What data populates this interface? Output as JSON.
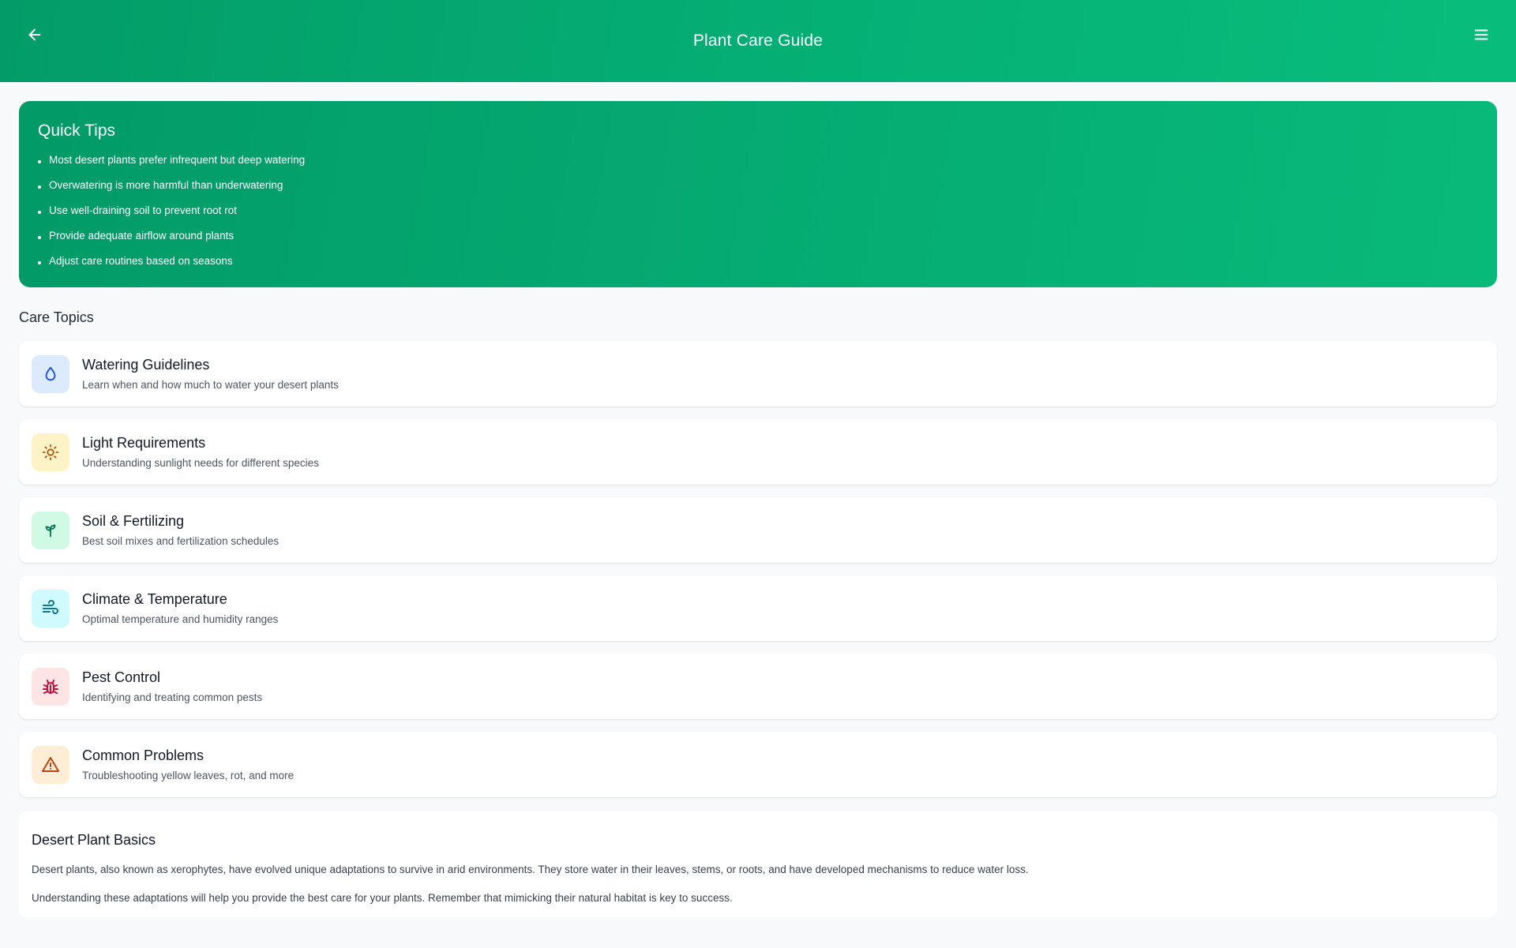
{
  "header": {
    "title": "Plant Care Guide"
  },
  "quick_tips": {
    "title": "Quick Tips",
    "items": [
      "Most desert plants prefer infrequent but deep watering",
      "Overwatering is more harmful than underwatering",
      "Use well-draining soil to prevent root rot",
      "Provide adequate airflow around plants",
      "Adjust care routines based on seasons"
    ]
  },
  "care_topics": {
    "heading": "Care Topics",
    "items": [
      {
        "title": "Watering Guidelines",
        "description": "Learn when and how much to water your desert plants",
        "icon": "water-drop-icon",
        "icon_color": "#1d4ed8",
        "icon_bg": "#dbeafe"
      },
      {
        "title": "Light Requirements",
        "description": "Understanding sunlight needs for different species",
        "icon": "sun-icon",
        "icon_color": "#b45309",
        "icon_bg": "#fef3c7"
      },
      {
        "title": "Soil & Fertilizing",
        "description": "Best soil mixes and fertilization schedules",
        "icon": "sprout-icon",
        "icon_color": "#047857",
        "icon_bg": "#d1fae5"
      },
      {
        "title": "Climate & Temperature",
        "description": "Optimal temperature and humidity ranges",
        "icon": "wind-icon",
        "icon_color": "#0e7490",
        "icon_bg": "#cffafe"
      },
      {
        "title": "Pest Control",
        "description": "Identifying and treating common pests",
        "icon": "bug-icon",
        "icon_color": "#be123c",
        "icon_bg": "#ffe4e6"
      },
      {
        "title": "Common Problems",
        "description": "Troubleshooting yellow leaves, rot, and more",
        "icon": "warning-icon",
        "icon_color": "#c2410c",
        "icon_bg": "#ffedd5"
      }
    ]
  },
  "basics": {
    "title": "Desert Plant Basics",
    "paragraphs": [
      "Desert plants, also known as xerophytes, have evolved unique adaptations to survive in arid environments. They store water in their leaves, stems, or roots, and have developed mechanisms to reduce water loss.",
      "Understanding these adaptations will help you provide the best care for your plants. Remember that mimicking their natural habitat is key to success."
    ]
  }
}
